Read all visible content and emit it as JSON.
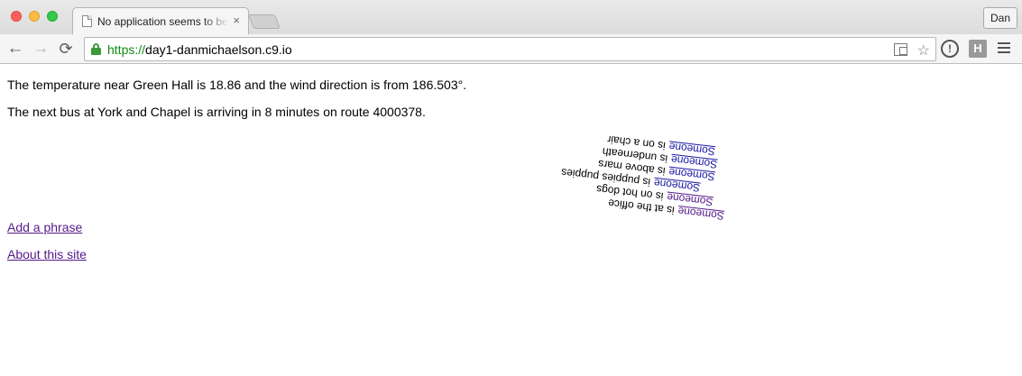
{
  "window": {
    "tab_title": "No application seems to be",
    "tab_close": "×",
    "profile_name": "Dan"
  },
  "toolbar": {
    "back_icon": "←",
    "forward_icon": "→",
    "reload_icon": "⟳",
    "url_scheme": "https://",
    "url_rest": "day1-danmichaelson.c9.io",
    "star_icon": "☆",
    "alert_icon": "!",
    "h_icon": "H"
  },
  "page": {
    "weather_text": "The temperature near Green Hall is 18.86 and the wind direction is from 186.503°.",
    "bus_text": "The next bus at York and Chapel is arriving in 8 minutes on route 4000378.",
    "rotation_degrees": 186.503,
    "phrases": [
      {
        "who": "Someone",
        "what": "is at the office",
        "color": "#551a8b"
      },
      {
        "who": "Someone",
        "what": "is on hot dogs",
        "color": "#551a8b"
      },
      {
        "who": "Someone",
        "what": "is puppies puppies",
        "color": "#1a1aa6"
      },
      {
        "who": "Someone",
        "what": "is above mars",
        "color": "#1a1aa6"
      },
      {
        "who": "Someone",
        "what": "is underneath",
        "color": "#1a1aa6"
      },
      {
        "who": "Someone",
        "what": "is on a chair",
        "color": "#1a1aa6"
      }
    ],
    "links": {
      "add_phrase": "Add a phrase",
      "about": "About this site"
    }
  }
}
